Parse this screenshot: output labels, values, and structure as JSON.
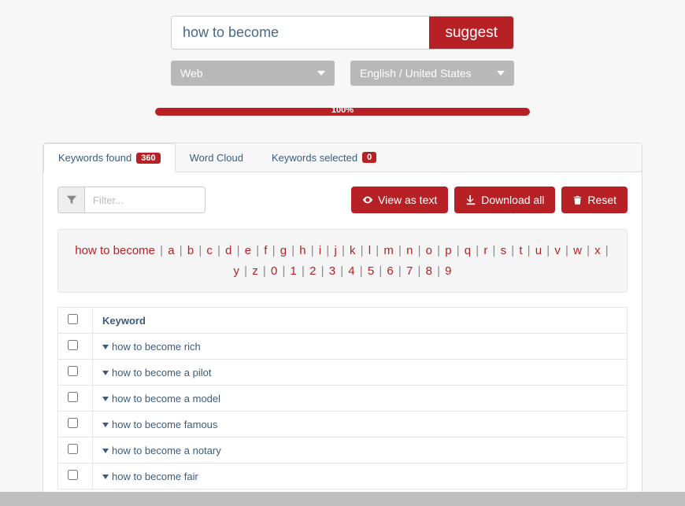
{
  "search": {
    "value": "how to become",
    "button": "suggest"
  },
  "selects": {
    "source": "Web",
    "locale": "English / United States"
  },
  "progress": {
    "percent_label": "100%"
  },
  "tabs": {
    "found_label": "Keywords found",
    "found_count": "360",
    "wordcloud_label": "Word Cloud",
    "selected_label": "Keywords selected",
    "selected_count": "0"
  },
  "filter": {
    "placeholder": "Filter..."
  },
  "actions": {
    "view": "View as text",
    "download": "Download all",
    "reset": "Reset"
  },
  "alpha": {
    "root": "how to become",
    "letters": [
      "a",
      "b",
      "c",
      "d",
      "e",
      "f",
      "g",
      "h",
      "i",
      "j",
      "k",
      "l",
      "m",
      "n",
      "o",
      "p",
      "q",
      "r",
      "s",
      "t",
      "u",
      "v",
      "w",
      "x",
      "y",
      "z",
      "0",
      "1",
      "2",
      "3",
      "4",
      "5",
      "6",
      "7",
      "8",
      "9"
    ]
  },
  "table": {
    "header": "Keyword",
    "rows": [
      "how to become rich",
      "how to become a pilot",
      "how to become a model",
      "how to become famous",
      "how to become a notary",
      "how to become fair"
    ]
  }
}
